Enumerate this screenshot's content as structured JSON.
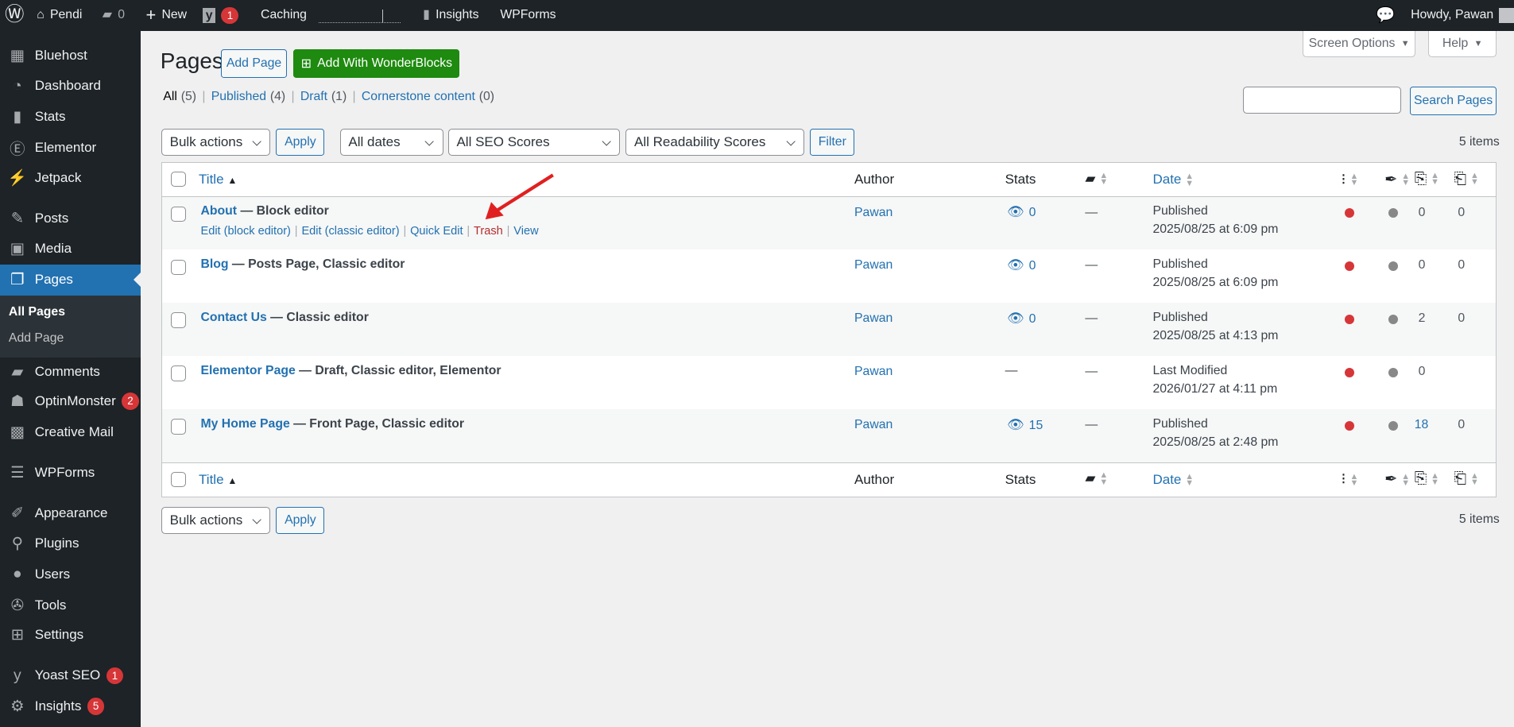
{
  "adminbar": {
    "site": "Pendi",
    "comments": "0",
    "new": "New",
    "yoast_count": "1",
    "caching": "Caching",
    "insights": "Insights",
    "wpforms": "WPForms",
    "howdy": "Howdy, Pawan"
  },
  "sidebar": {
    "items": [
      {
        "label": "Bluehost",
        "icon": "grid-icon",
        "glyph": "▦"
      },
      {
        "label": "Dashboard",
        "icon": "dashboard-icon",
        "glyph": "◔"
      },
      {
        "label": "Stats",
        "icon": "stats-icon",
        "glyph": "▮"
      },
      {
        "label": "Elementor",
        "icon": "elementor-icon",
        "glyph": "Ⓔ"
      },
      {
        "label": "Jetpack",
        "icon": "jetpack-icon",
        "glyph": "⚡"
      },
      {
        "label": "Posts",
        "icon": "pin-icon",
        "glyph": "✎"
      },
      {
        "label": "Media",
        "icon": "media-icon",
        "glyph": "▣"
      },
      {
        "label": "Pages",
        "icon": "pages-icon",
        "glyph": "❐"
      },
      {
        "label": "Comments",
        "icon": "comments-icon",
        "glyph": "▰"
      },
      {
        "label": "OptinMonster",
        "icon": "optinmonster-icon",
        "glyph": "☗",
        "badge": "2"
      },
      {
        "label": "Creative Mail",
        "icon": "creative-mail-icon",
        "glyph": "▩"
      },
      {
        "label": "WPForms",
        "icon": "wpforms-icon",
        "glyph": "☰"
      },
      {
        "label": "Appearance",
        "icon": "appearance-icon",
        "glyph": "✐"
      },
      {
        "label": "Plugins",
        "icon": "plugins-icon",
        "glyph": "⚲"
      },
      {
        "label": "Users",
        "icon": "users-icon",
        "glyph": "●"
      },
      {
        "label": "Tools",
        "icon": "tools-icon",
        "glyph": "✇"
      },
      {
        "label": "Settings",
        "icon": "settings-icon",
        "glyph": "⊞"
      },
      {
        "label": "Yoast SEO",
        "icon": "yoast-icon",
        "glyph": "y",
        "badge": "1"
      },
      {
        "label": "Insights",
        "icon": "insights-icon",
        "glyph": "⚙",
        "badge": "5"
      }
    ],
    "submenu": [
      "All Pages",
      "Add Page"
    ]
  },
  "header": {
    "title": "Pages",
    "add_page": "Add Page",
    "wonderblocks": "Add With WonderBlocks",
    "screen_options": "Screen Options",
    "help": "Help"
  },
  "filters": {
    "views": [
      {
        "label": "All",
        "count": "(5)"
      },
      {
        "label": "Published",
        "count": "(4)"
      },
      {
        "label": "Draft",
        "count": "(1)"
      },
      {
        "label": "Cornerstone content",
        "count": "(0)"
      }
    ],
    "search_value": "",
    "search_button": "Search Pages",
    "bulk": "Bulk actions",
    "apply": "Apply",
    "dates": "All dates",
    "seo": "All SEO Scores",
    "readability": "All Readability Scores",
    "filter": "Filter",
    "items": "5 items"
  },
  "table": {
    "headers": {
      "title": "Title",
      "author": "Author",
      "stats": "Stats",
      "date": "Date"
    },
    "row_actions": [
      "Edit (block editor)",
      "Edit (classic editor)",
      "Quick Edit",
      "Trash",
      "View"
    ],
    "rows": [
      {
        "title": "About",
        "state": " — Block editor",
        "author": "Pawan",
        "stats": "0",
        "comments": "—",
        "status": "Published",
        "date": "2025/08/25 at 6:09 pm",
        "links": "0",
        "linked": "0"
      },
      {
        "title": "Blog",
        "state": " — Posts Page, Classic editor",
        "author": "Pawan",
        "stats": "0",
        "comments": "—",
        "status": "Published",
        "date": "2025/08/25 at 6:09 pm",
        "links": "0",
        "linked": "0"
      },
      {
        "title": "Contact Us",
        "state": " — Classic editor",
        "author": "Pawan",
        "stats": "0",
        "comments": "—",
        "status": "Published",
        "date": "2025/08/25 at 4:13 pm",
        "links": "2",
        "linked": "0"
      },
      {
        "title": "Elementor Page",
        "state": " — Draft, Classic editor, Elementor",
        "author": "Pawan",
        "stats": "—",
        "comments": "—",
        "status": "Last Modified",
        "date": "2026/01/27 at 4:11 pm",
        "links": "0",
        "linked": ""
      },
      {
        "title": "My Home Page",
        "state": " — Front Page, Classic editor",
        "author": "Pawan",
        "stats": "15",
        "comments": "—",
        "status": "Published",
        "date": "2025/08/25 at 2:48 pm",
        "links": "18",
        "linked": "0"
      }
    ]
  },
  "colors": {
    "seo": "#d63638",
    "readability": "#888888",
    "accent": "#2271b1",
    "green": "#1e8a0f"
  }
}
